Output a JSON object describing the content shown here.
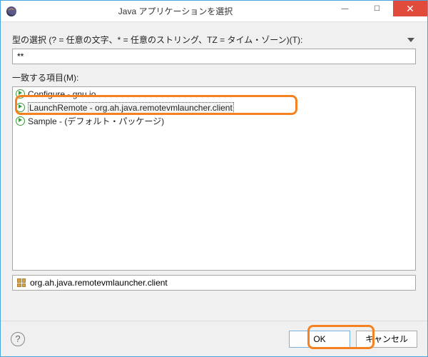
{
  "titlebar": {
    "title": "Java アプリケーションを選択"
  },
  "labels": {
    "type_select": "型の選択 (? = 任意の文字、* = 任意のストリング、TZ = タイム・ゾーン)(T):",
    "matching": "一致する項目(M):"
  },
  "input": {
    "value": "**"
  },
  "items": [
    {
      "label": "Configure - gnu.io"
    },
    {
      "label": "LaunchRemote - org.ah.java.remotevmlauncher.client",
      "selected": true
    },
    {
      "label": "Sample - (デフォルト・パッケージ)"
    }
  ],
  "package": {
    "label": "org.ah.java.remotevmlauncher.client"
  },
  "buttons": {
    "ok": "OK",
    "cancel": "キャンセル"
  }
}
